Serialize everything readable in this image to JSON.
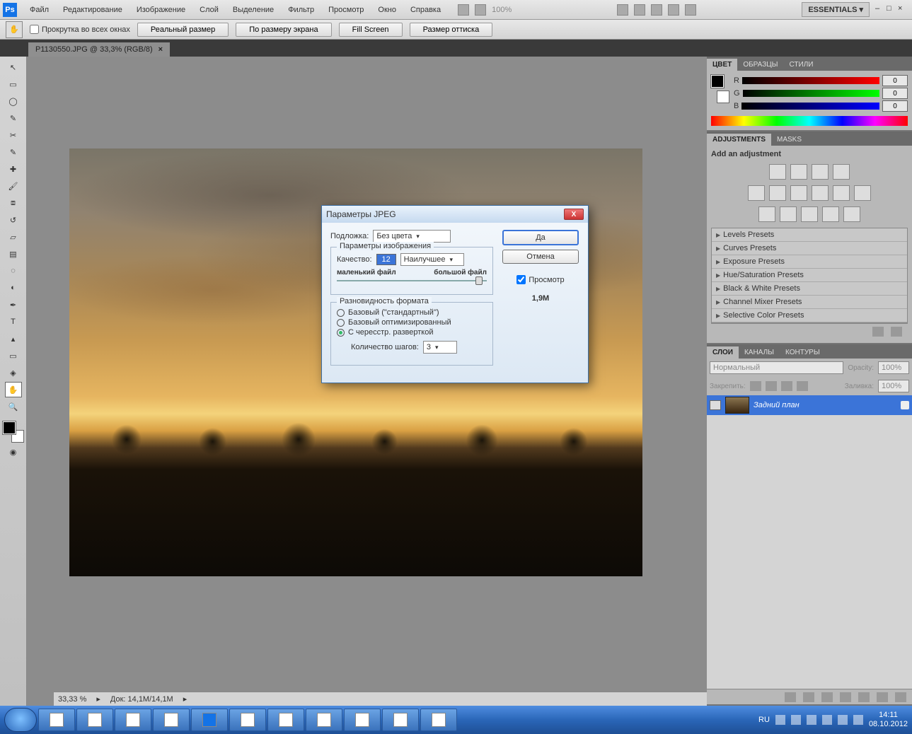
{
  "menubar": {
    "items": [
      "Файл",
      "Редактирование",
      "Изображение",
      "Слой",
      "Выделение",
      "Фильтр",
      "Просмотр",
      "Окно",
      "Справка"
    ],
    "zoom": "100%",
    "workspace": "ESSENTIALS ▾"
  },
  "optbar": {
    "scroll_all": "Прокрутка во всех окнах",
    "btn_actual": "Реальный размер",
    "btn_fit": "По размеру экрана",
    "btn_fill": "Fill Screen",
    "btn_print": "Размер оттиска"
  },
  "tab": {
    "title": "P1130550.JPG @ 33,3% (RGB/8)"
  },
  "status": {
    "zoom": "33,33 %",
    "doc": "Док: 14,1M/14,1M"
  },
  "color_panel": {
    "tabs": [
      "ЦВЕТ",
      "ОБРАЗЦЫ",
      "СТИЛИ"
    ],
    "r": "0",
    "g": "0",
    "b": "0"
  },
  "adjustments": {
    "tabs": [
      "ADJUSTMENTS",
      "MASKS"
    ],
    "title": "Add an adjustment",
    "presets": [
      "Levels Presets",
      "Curves Presets",
      "Exposure Presets",
      "Hue/Saturation Presets",
      "Black & White Presets",
      "Channel Mixer Presets",
      "Selective Color Presets"
    ]
  },
  "layers": {
    "tabs": [
      "СЛОИ",
      "КАНАЛЫ",
      "КОНТУРЫ"
    ],
    "blend": "Нормальный",
    "opacity_label": "Opacity:",
    "opacity": "100%",
    "lock_label": "Закрепить:",
    "fill_label": "Заливка:",
    "fill": "100%",
    "bg_layer": "Задний план"
  },
  "dialog": {
    "title": "Параметры JPEG",
    "matte_label": "Подложка:",
    "matte_value": "Без цвета",
    "group_image": "Параметры изображения",
    "quality_label": "Качество:",
    "quality_value": "12",
    "quality_preset": "Наилучшее",
    "slider_small": "маленький файл",
    "slider_big": "большой файл",
    "group_format": "Разновидность формата",
    "radio_baseline": "Базовый (\"стандартный\")",
    "radio_optimized": "Базовый оптимизированный",
    "radio_progressive": "С чересстр. разверткой",
    "scans_label": "Количество шагов:",
    "scans_value": "3",
    "btn_ok": "Да",
    "btn_cancel": "Отмена",
    "chk_preview": "Просмотр",
    "filesize": "1,9M"
  },
  "taskbar": {
    "lang": "RU",
    "time": "14:11",
    "date": "08.10.2012"
  }
}
